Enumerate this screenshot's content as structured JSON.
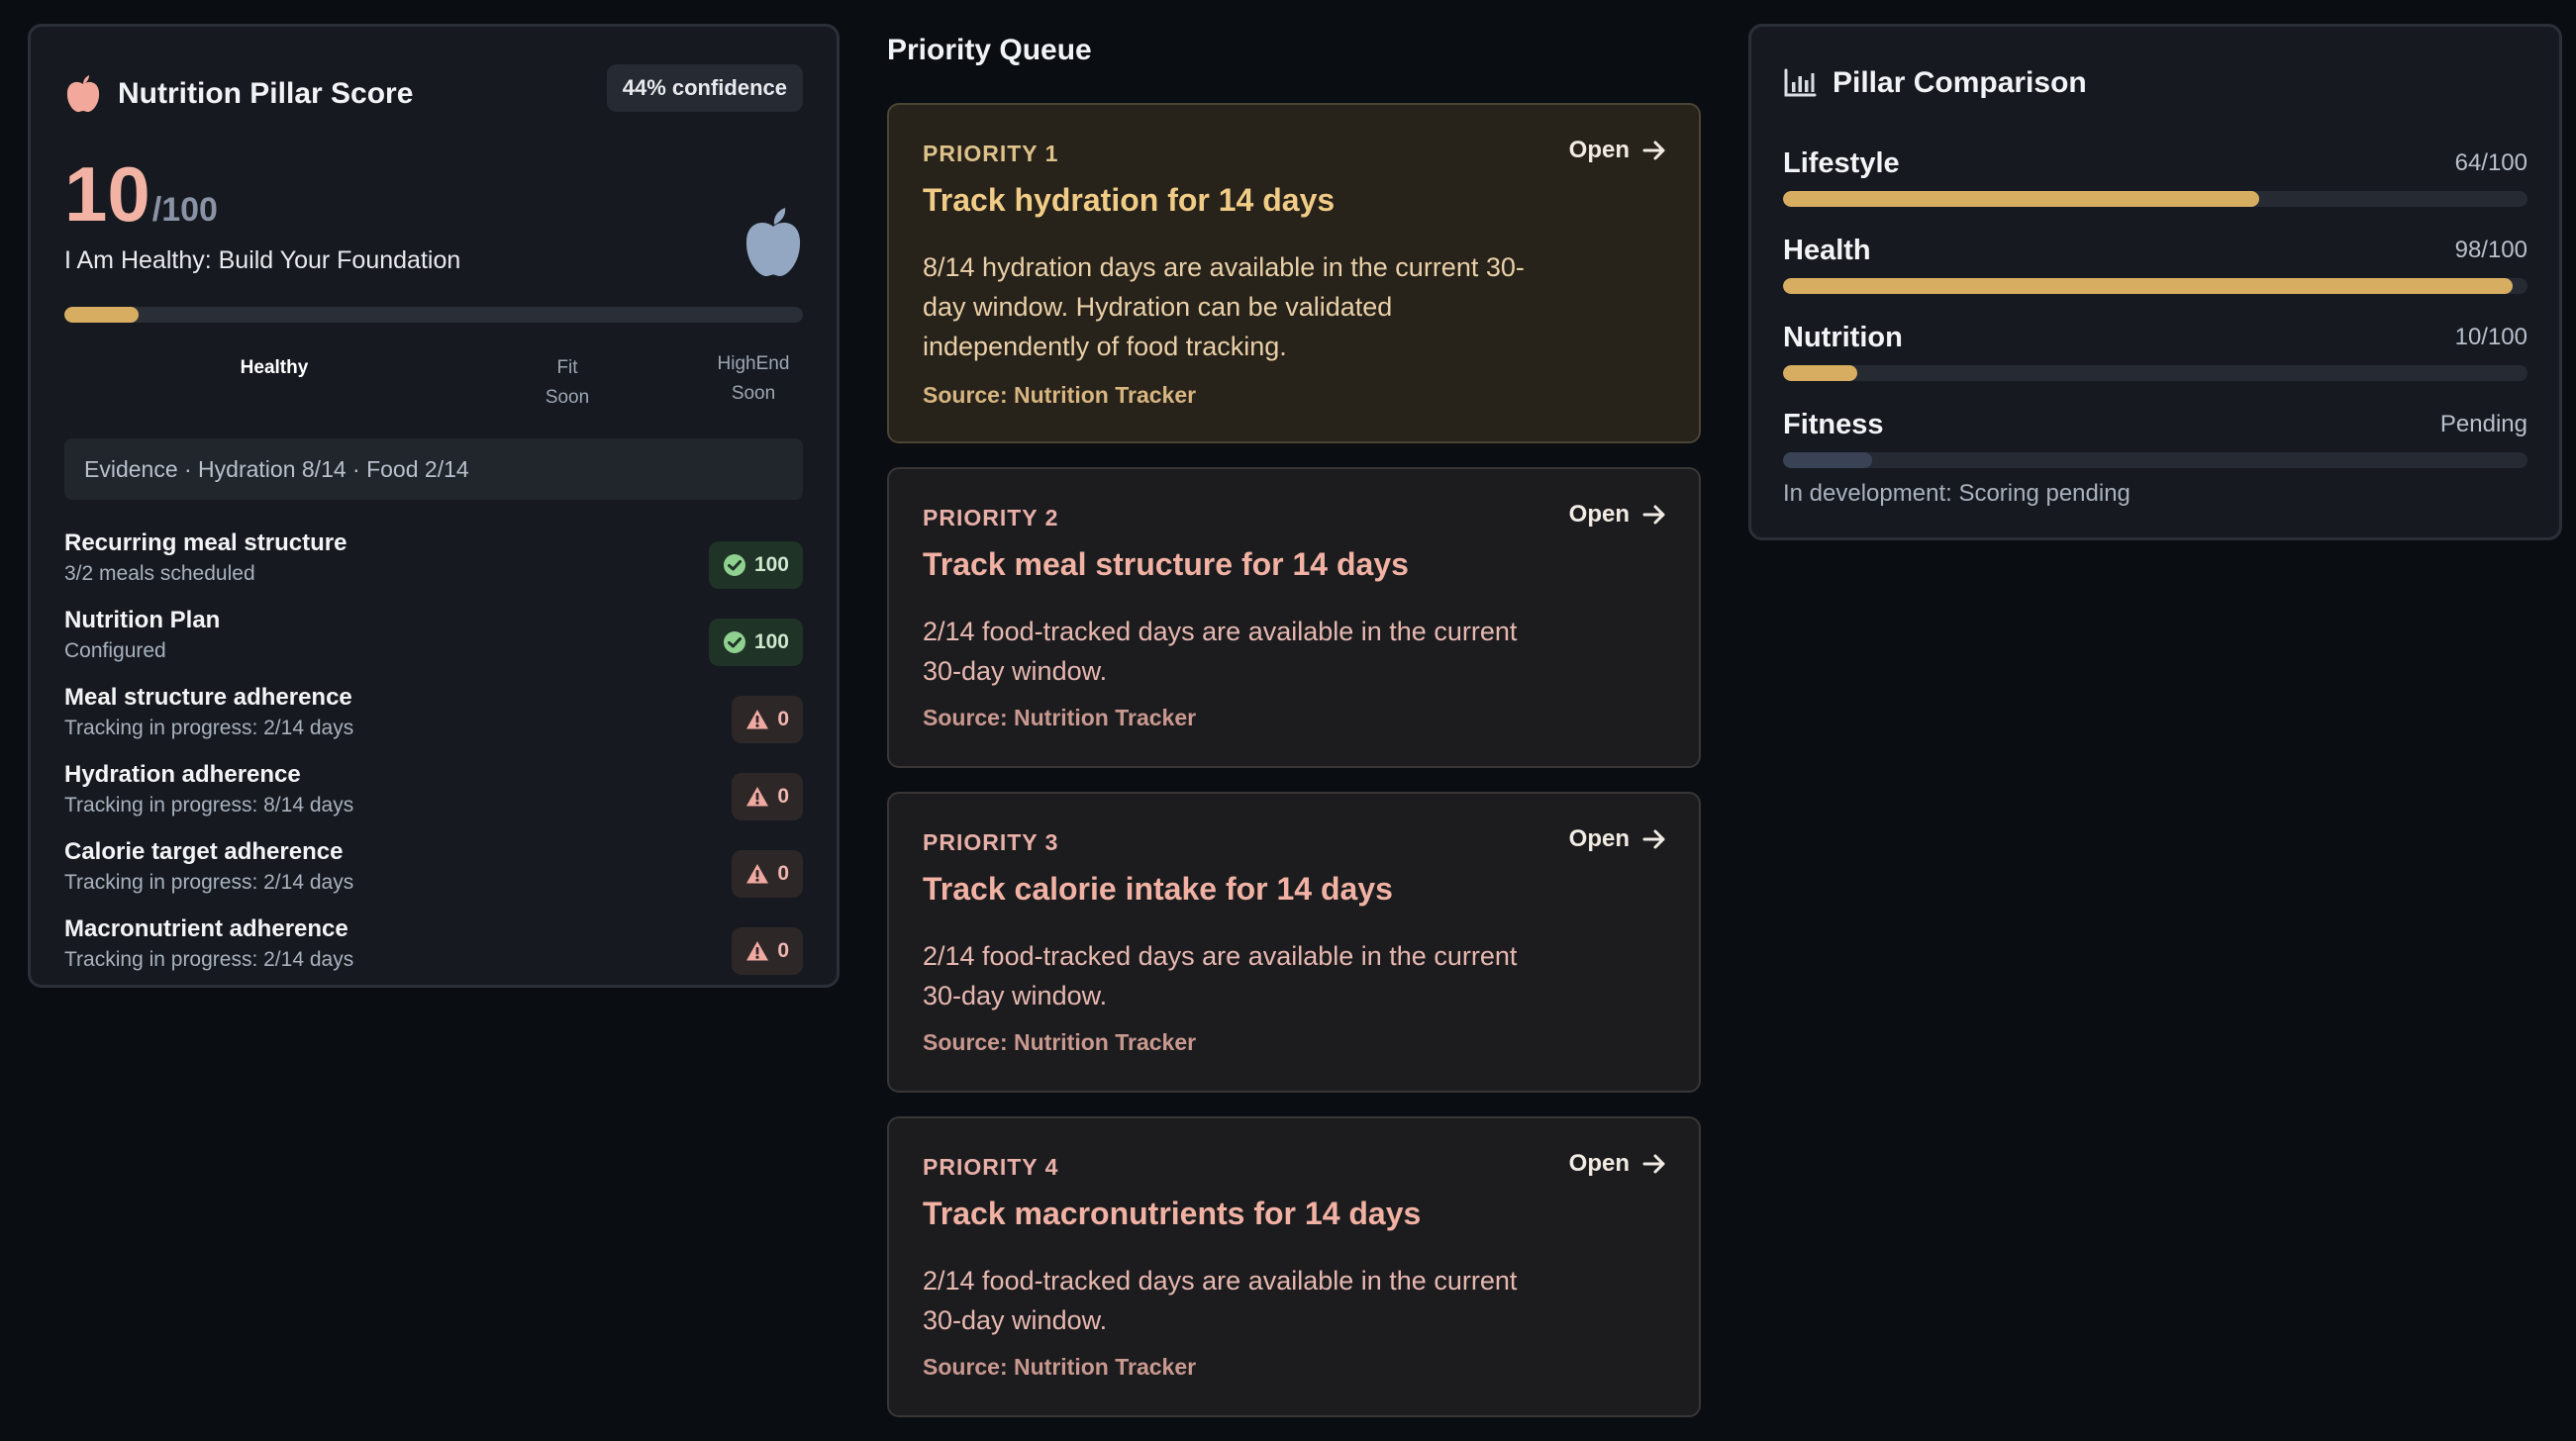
{
  "score_card": {
    "title": "Nutrition Pillar Score",
    "confidence": "44% confidence",
    "score": "10",
    "score_max": "/100",
    "tier_name": "I Am Healthy: Build Your Foundation",
    "progress": 0.1,
    "tiers": [
      {
        "label": "Healthy",
        "active": true
      },
      {
        "label": "Fit\nSoon",
        "active": false
      },
      {
        "label": "HighEnd\nSoon",
        "active": false
      }
    ],
    "evidence": "Evidence · Hydration 8/14 · Food 2/14",
    "metrics": [
      {
        "title": "Recurring meal structure",
        "sub": "3/2 meals scheduled",
        "badge": "100",
        "status": "ok"
      },
      {
        "title": "Nutrition Plan",
        "sub": "Configured",
        "badge": "100",
        "status": "ok"
      },
      {
        "title": "Meal structure adherence",
        "sub": "Tracking in progress: 2/14 days",
        "badge": "0",
        "status": "warn"
      },
      {
        "title": "Hydration adherence",
        "sub": "Tracking in progress: 8/14 days",
        "badge": "0",
        "status": "warn"
      },
      {
        "title": "Calorie target adherence",
        "sub": "Tracking in progress: 2/14 days",
        "badge": "0",
        "status": "warn"
      },
      {
        "title": "Macronutrient adherence",
        "sub": "Tracking in progress: 2/14 days",
        "badge": "0",
        "status": "warn"
      }
    ],
    "icons": {
      "title": "apple-icon",
      "ok": "check-circle-icon",
      "warn": "warning-triangle-icon"
    }
  },
  "queue": {
    "title": "Priority Queue",
    "open_label": "Open",
    "items": [
      {
        "label": "PRIORITY 1",
        "title": "Track hydration for 14 days",
        "desc": "8/14 hydration days are available in the current 30-day window. Hydration can be validated independently of food tracking.",
        "source": "Source: Nutrition Tracker"
      },
      {
        "label": "PRIORITY 2",
        "title": "Track meal structure for 14 days",
        "desc": "2/14 food-tracked days are available in the current 30-day window.",
        "source": "Source: Nutrition Tracker"
      },
      {
        "label": "PRIORITY 3",
        "title": "Track calorie intake for 14 days",
        "desc": "2/14 food-tracked days are available in the current 30-day window.",
        "source": "Source: Nutrition Tracker"
      },
      {
        "label": "PRIORITY 4",
        "title": "Track macronutrients for 14 days",
        "desc": "2/14 food-tracked days are available in the current 30-day window.",
        "source": "Source: Nutrition Tracker"
      }
    ]
  },
  "comparison": {
    "title": "Pillar Comparison",
    "pillars": [
      {
        "name": "Lifestyle",
        "value": "64/100",
        "fraction": 0.64,
        "color": "#d7ad62"
      },
      {
        "name": "Health",
        "value": "98/100",
        "fraction": 0.98,
        "color": "#d7ad62"
      },
      {
        "name": "Nutrition",
        "value": "10/100",
        "fraction": 0.1,
        "color": "#d7ad62"
      },
      {
        "name": "Fitness",
        "value": "Pending",
        "fraction": 0.12,
        "color": "#3a4256"
      }
    ],
    "note": "In development: Scoring pending"
  },
  "colors": {
    "accent": "#d7ad62",
    "score": "#f3b3a4",
    "ok_bg": "#1f3326",
    "warn_bg": "#2e2727"
  }
}
